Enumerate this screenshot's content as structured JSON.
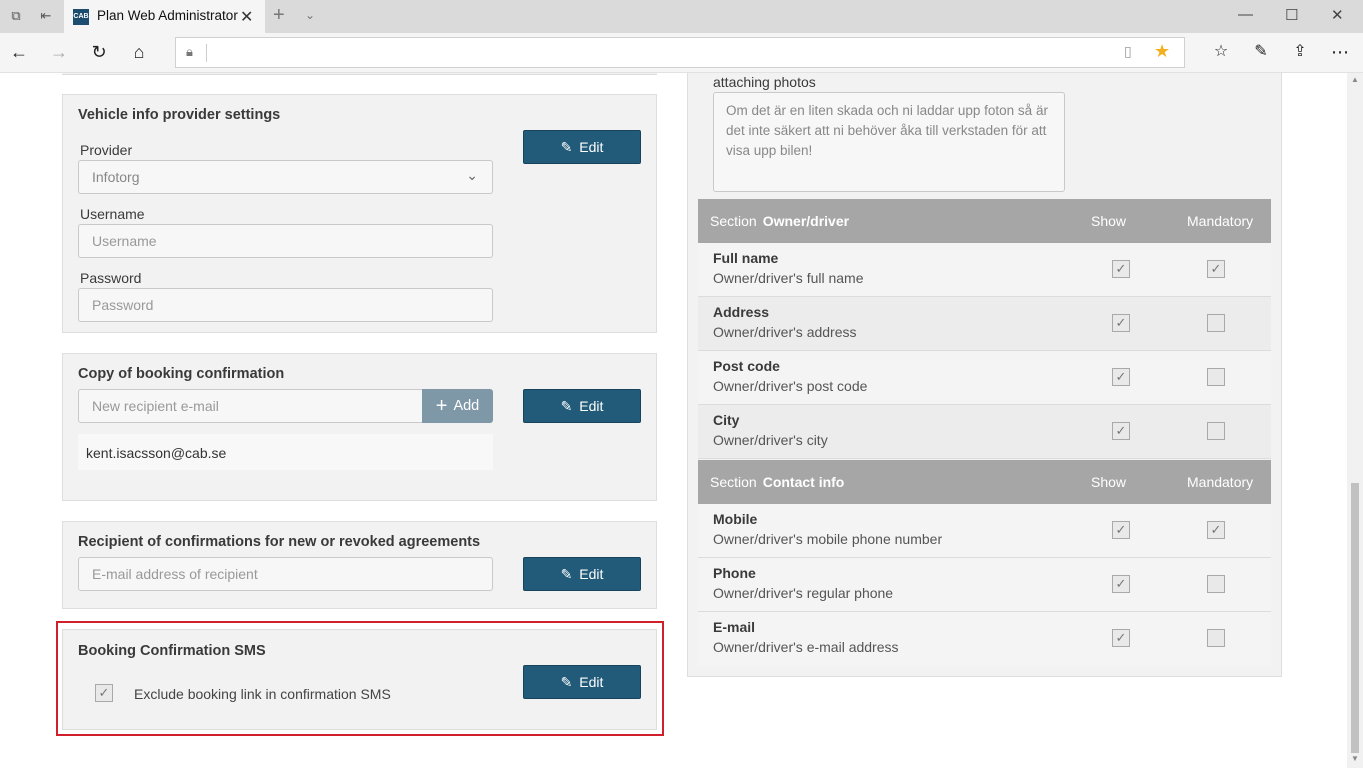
{
  "browser": {
    "tab_title": "Plan Web Administrator",
    "favicon_text": "CAB",
    "address": ""
  },
  "left": {
    "vehicle": {
      "title": "Vehicle info provider settings",
      "provider_label": "Provider",
      "provider_value": "Infotorg",
      "username_label": "Username",
      "username_placeholder": "Username",
      "password_label": "Password",
      "password_placeholder": "Password",
      "edit": "Edit"
    },
    "copy": {
      "title": "Copy of booking confirmation",
      "recipient_placeholder": "New recipient e-mail",
      "add": "Add",
      "edit": "Edit",
      "emails": [
        "kent.isacsson@cab.se"
      ]
    },
    "agreements": {
      "title": "Recipient of confirmations for new or revoked agreements",
      "placeholder": "E-mail address of recipient",
      "edit": "Edit"
    },
    "sms": {
      "title": "Booking Confirmation SMS",
      "exclude_label": "Exclude booking link in confirmation SMS",
      "exclude_checked": true,
      "edit": "Edit"
    }
  },
  "right": {
    "photos_label": "attaching photos",
    "photos_text": "Om det är en liten skada och ni laddar upp foton så är det inte säkert att ni behöver åka till verkstaden för att visa upp bilen!",
    "sections": [
      {
        "prefix": "Section",
        "name": "Owner/driver",
        "show": "Show",
        "mandatory": "Mandatory",
        "rows": [
          {
            "title": "Full name",
            "desc": "Owner/driver's full name",
            "show": true,
            "mandatory": true
          },
          {
            "title": "Address",
            "desc": "Owner/driver's address",
            "show": true,
            "mandatory": false
          },
          {
            "title": "Post code",
            "desc": "Owner/driver's post code",
            "show": true,
            "mandatory": false
          },
          {
            "title": "City",
            "desc": "Owner/driver's city",
            "show": true,
            "mandatory": false
          }
        ]
      },
      {
        "prefix": "Section",
        "name": "Contact info",
        "show": "Show",
        "mandatory": "Mandatory",
        "rows": [
          {
            "title": "Mobile",
            "desc": "Owner/driver's mobile phone number",
            "show": true,
            "mandatory": true
          },
          {
            "title": "Phone",
            "desc": "Owner/driver's regular phone",
            "show": true,
            "mandatory": false
          },
          {
            "title": "E-mail",
            "desc": "Owner/driver's e-mail address",
            "show": true,
            "mandatory": false
          }
        ]
      }
    ]
  }
}
